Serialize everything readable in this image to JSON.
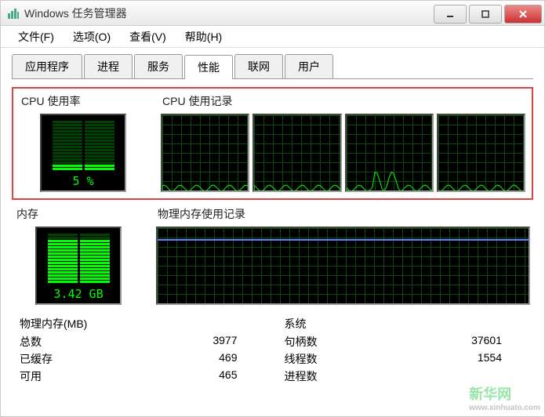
{
  "title": "Windows 任务管理器",
  "menu": {
    "file": "文件(F)",
    "options": "选项(O)",
    "view": "查看(V)",
    "help": "帮助(H)"
  },
  "tabs": {
    "applications": "应用程序",
    "processes": "进程",
    "services": "服务",
    "performance": "性能",
    "networking": "联网",
    "users": "用户"
  },
  "cpu": {
    "usage_label": "CPU 使用率",
    "history_label": "CPU 使用记录",
    "usage_text": "5 %"
  },
  "memory": {
    "label": "内存",
    "history_label": "物理内存使用记录",
    "usage_text": "3.42 GB"
  },
  "physical_memory": {
    "title": "物理内存(MB)",
    "total_label": "总数",
    "total_value": "3977",
    "cached_label": "已缓存",
    "cached_value": "469",
    "available_label": "可用",
    "available_value": "465"
  },
  "system": {
    "title": "系统",
    "handles_label": "句柄数",
    "handles_value": "37601",
    "threads_label": "线程数",
    "threads_value": "1554",
    "processes_label": "进程数"
  },
  "chart_data": {
    "cpu_usage_percent": 5,
    "memory_usage_gb": 3.42,
    "cpu_cores": 4,
    "cpu_history": {
      "type": "line",
      "series_count": 4,
      "ylim": [
        0,
        100
      ],
      "note": "Four small sparkline charts showing per-core CPU usage history at low levels, roughly 0-15% with occasional spikes"
    },
    "memory_history": {
      "type": "line",
      "ylim": [
        0,
        4096
      ],
      "note": "Single wide chart showing flat memory usage line around 3.42GB / ~85% level"
    }
  },
  "watermark": {
    "main": "新华网",
    "sub": "www.xinhuato.com"
  }
}
